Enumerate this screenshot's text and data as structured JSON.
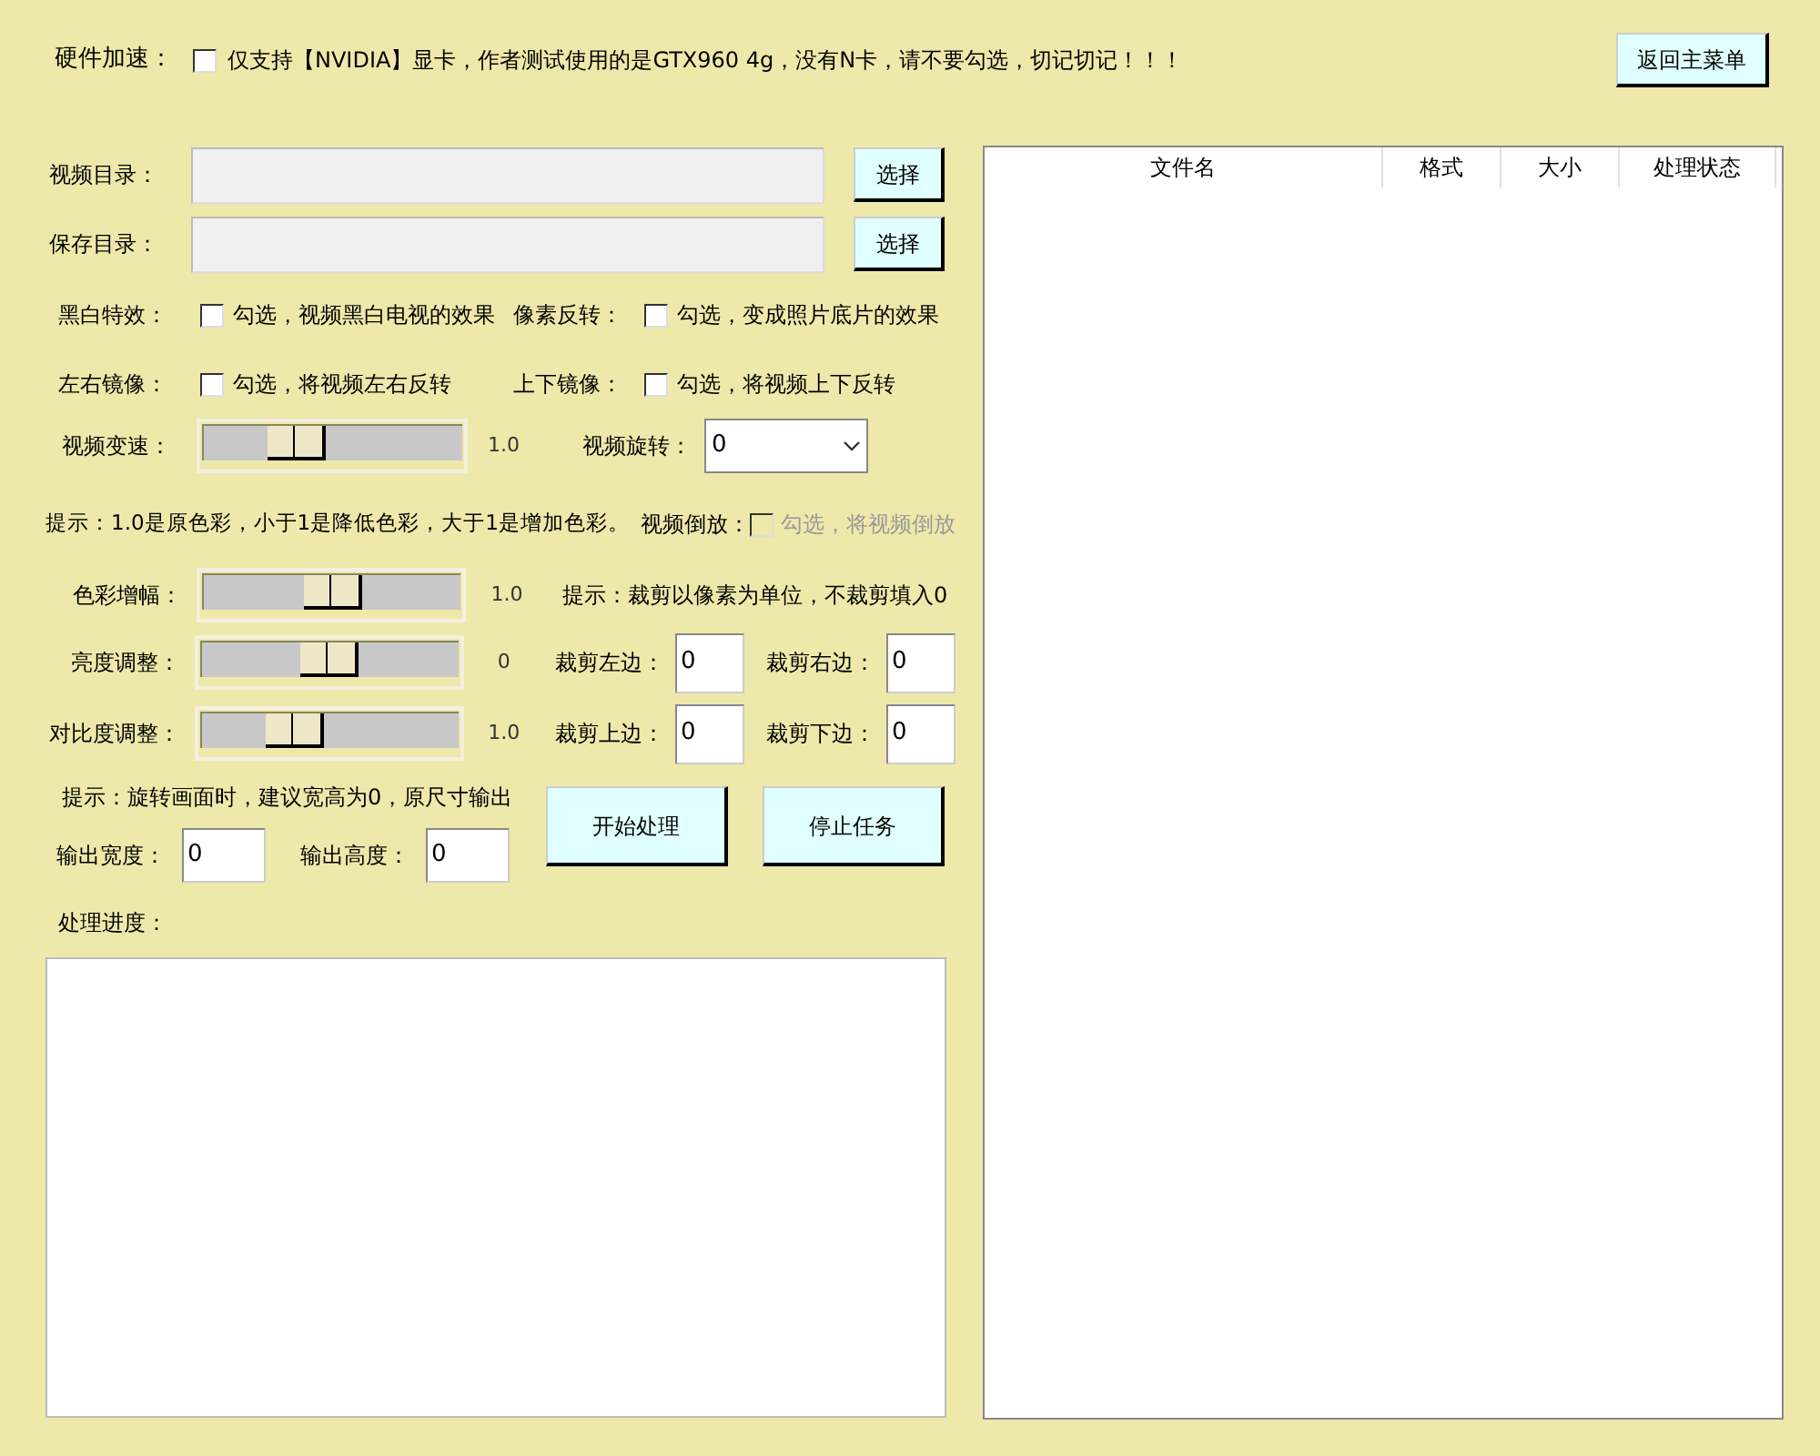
{
  "hardware": {
    "label": "硬件加速：",
    "checked": false,
    "text": "仅支持【NVIDIA】显卡，作者测试使用的是GTX960 4g，没有N卡，请不要勾选，切记切记！！！"
  },
  "return_button": "返回主菜单",
  "directories": [
    {
      "label": "视频目录：",
      "button": "选择"
    },
    {
      "label": "保存目录：",
      "button": "选择"
    }
  ],
  "effect_rows": [
    [
      {
        "label": "黑白特效：",
        "checked": false,
        "text": "勾选，视频黑白电视的效果"
      },
      {
        "label": "像素反转：",
        "checked": false,
        "text": "勾选，变成照片底片的效果"
      }
    ],
    [
      {
        "label": "左右镜像：",
        "checked": false,
        "text": "勾选，将视频左右反转"
      },
      {
        "label": "上下镜像：",
        "checked": false,
        "text": "勾选，将视频上下反转"
      }
    ]
  ],
  "speed": {
    "label": "视频变速：",
    "level": 0.36,
    "reading": "1.0"
  },
  "rotation": {
    "label": "视频旋转：",
    "value": "0"
  },
  "color_hint": "提示：1.0是原色彩，小于1是降低色彩，大于1是增加色彩。",
  "reverse": {
    "label": "视频倒放：",
    "checked": false,
    "disabled": true,
    "text": "勾选，将视频倒放"
  },
  "sliders": [
    {
      "label": "色彩增幅：",
      "level": 0.5,
      "reading": "1.0"
    },
    {
      "label": "亮度调整：",
      "level": 0.5,
      "reading": "0"
    },
    {
      "label": "对比度调整：",
      "level": 0.36,
      "reading": "1.0"
    }
  ],
  "crop_hint": "提示：裁剪以像素为单位，不裁剪填入0",
  "crop_rows": [
    [
      {
        "label": "裁剪左边：",
        "value": "0"
      },
      {
        "label": "裁剪右边：",
        "value": "0"
      }
    ],
    [
      {
        "label": "裁剪上边：",
        "value": "0"
      },
      {
        "label": "裁剪下边：",
        "value": "0"
      }
    ]
  ],
  "rotate_hint": "提示：旋转画面时，建议宽高为0，原尺寸输出",
  "output_fields": [
    {
      "label": "输出宽度：",
      "value": "0"
    },
    {
      "label": "输出高度：",
      "value": "0"
    }
  ],
  "action_buttons": [
    "开始处理",
    "停止任务"
  ],
  "progress_label": "处理进度：",
  "table": {
    "columns": [
      "文件名",
      "格式",
      "大小",
      "处理状态"
    ]
  }
}
